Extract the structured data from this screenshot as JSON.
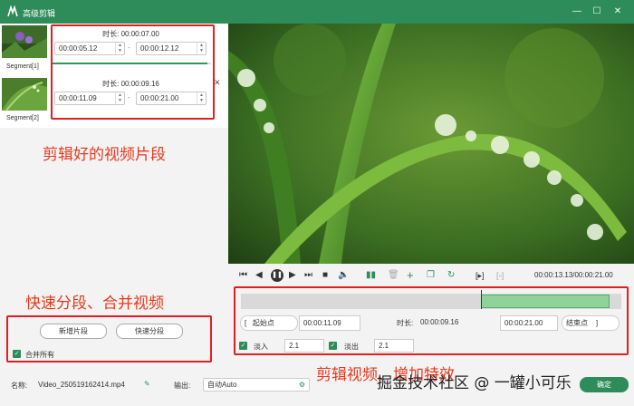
{
  "window": {
    "title": "高级剪辑",
    "min": "—",
    "max": "☐",
    "close": "✕"
  },
  "segments": [
    {
      "label": "Segment[1]",
      "duration": "时长: 00:00:07.00",
      "start": "00:00:05.12",
      "end": "00:00:12.12",
      "dash": "-",
      "progress": 0.98
    },
    {
      "label": "Segment[2]",
      "duration": "时长: 00:00:09.16",
      "start": "00:00:11.09",
      "end": "00:00:21.00",
      "dash": "-",
      "progress": 0.0
    }
  ],
  "annotations": {
    "segments": "剪辑好的视频片段",
    "split": "快速分段、合并视频",
    "edit": "剪辑视频、增加特效"
  },
  "left_buttons": {
    "new_segment": "新增片段",
    "quick_split": "快速分段",
    "merge_all": "合并所有"
  },
  "player": {
    "time": "00:00:13.13/00:00:21.00",
    "playhead": 0.63,
    "selection": [
      0.63,
      0.97
    ]
  },
  "trim": {
    "start_btn": "起始点",
    "start_val": "00:00:11.09",
    "dur_label": "时长:",
    "dur_val": "00:00:09.16",
    "end_val": "00:00:21.00",
    "end_btn": "结束点",
    "open_bracket": "[",
    "close_bracket": "]"
  },
  "effects": {
    "fade_in": "淡入",
    "fade_in_val": "2.1",
    "fade_out": "淡出",
    "fade_out_val": "2.1"
  },
  "bottom": {
    "name_label": "名称:",
    "name_value": "Video_250519162414.mp4",
    "output_label": "输出:",
    "output_value": "自动Auto",
    "watermark": "掘金技术社区 @ 一罐小可乐",
    "ok_btn": "确定"
  }
}
